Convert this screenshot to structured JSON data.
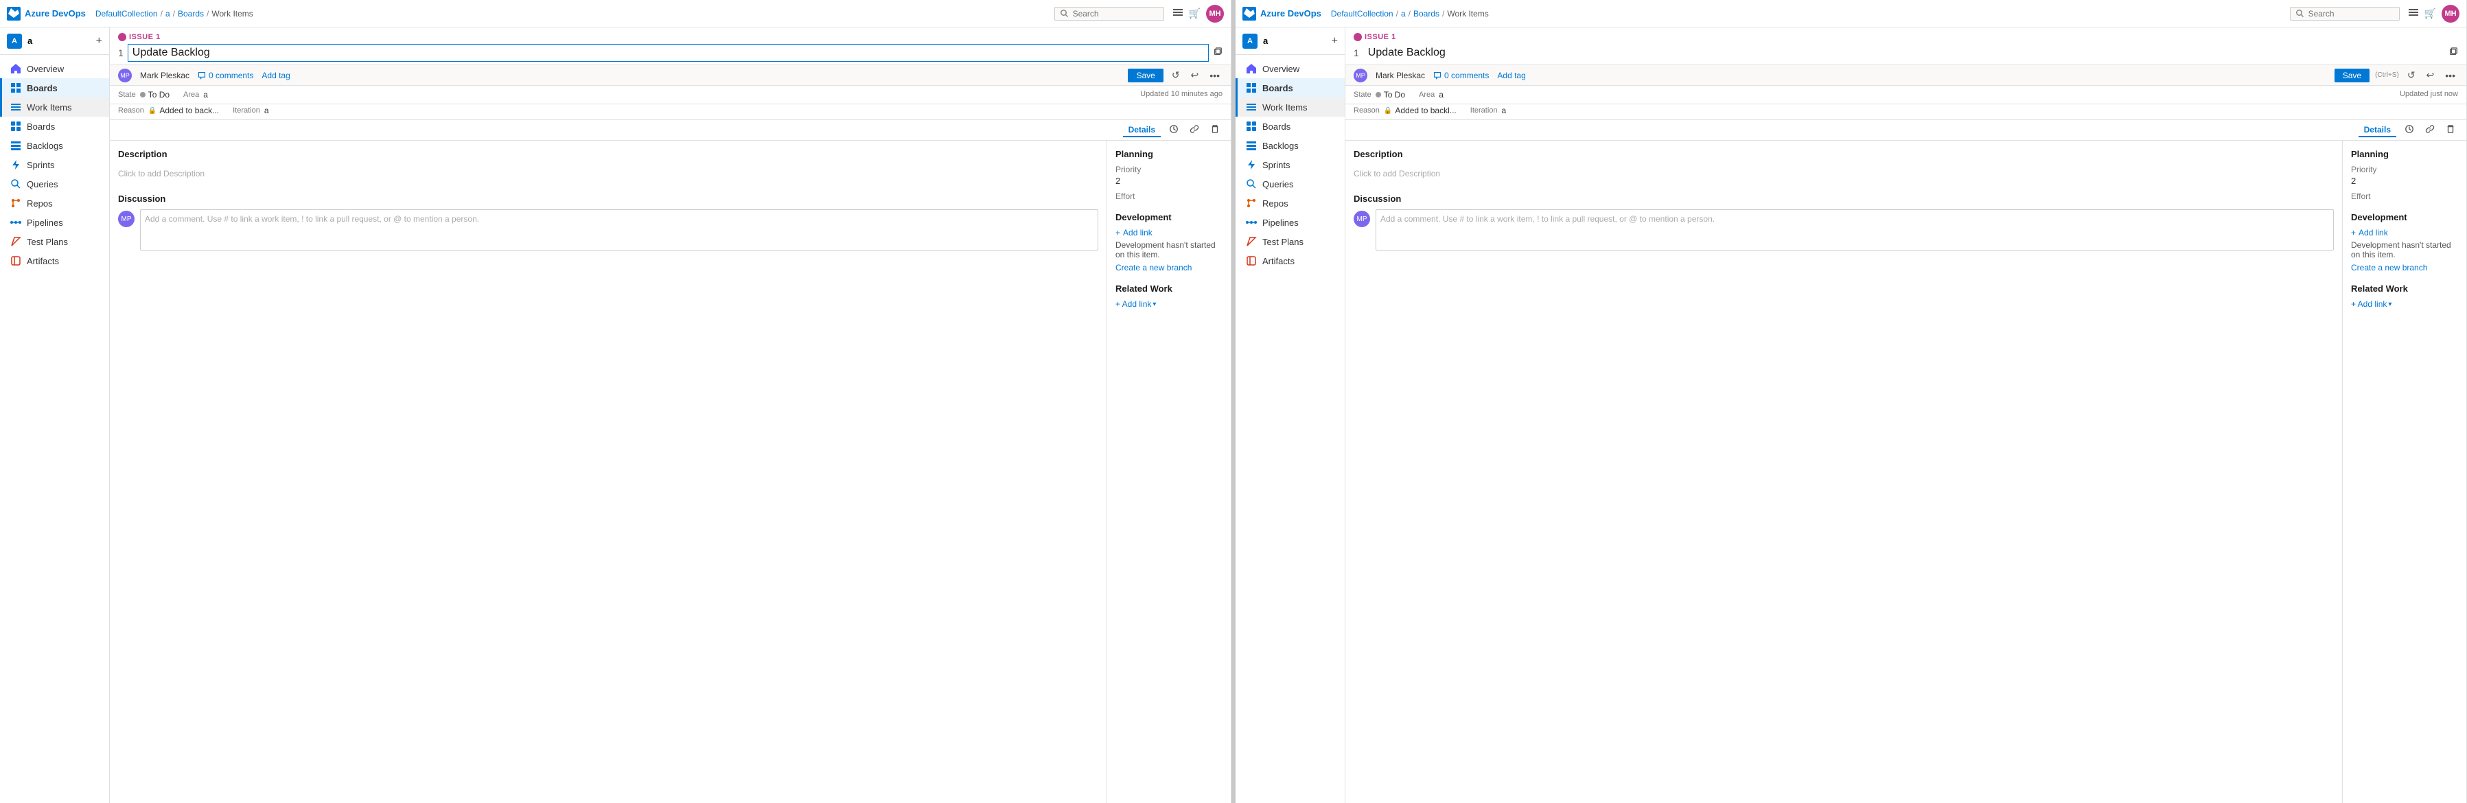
{
  "panels": [
    {
      "id": "left",
      "topbar": {
        "logo_text": "Azure DevOps",
        "breadcrumb": [
          "DefaultCollection",
          "a",
          "Boards",
          "Work Items"
        ],
        "search_placeholder": "Search",
        "avatar_initials": "MH"
      },
      "sidebar": {
        "project_name": "a",
        "project_initial": "A",
        "nav_items": [
          {
            "id": "overview",
            "label": "Overview",
            "icon": "home"
          },
          {
            "id": "boards",
            "label": "Boards",
            "icon": "boards",
            "active": true
          },
          {
            "id": "work-items",
            "label": "Work Items",
            "icon": "list",
            "sub_active": true
          },
          {
            "id": "boards2",
            "label": "Boards",
            "icon": "grid"
          },
          {
            "id": "backlogs",
            "label": "Backlogs",
            "icon": "bars"
          },
          {
            "id": "sprints",
            "label": "Sprints",
            "icon": "lightning"
          },
          {
            "id": "queries",
            "label": "Queries",
            "icon": "search"
          },
          {
            "id": "repos",
            "label": "Repos",
            "icon": "repo"
          },
          {
            "id": "pipelines",
            "label": "Pipelines",
            "icon": "pipeline"
          },
          {
            "id": "test-plans",
            "label": "Test Plans",
            "icon": "test"
          },
          {
            "id": "artifacts",
            "label": "Artifacts",
            "icon": "artifact"
          }
        ]
      },
      "workitem": {
        "issue_label": "ISSUE 1",
        "number": "1",
        "title": "Update Backlog",
        "assignee": "Mark Pleskac",
        "comments": "0 comments",
        "add_tag": "Add tag",
        "state_label": "State",
        "state_value": "To Do",
        "area_label": "Area",
        "area_value": "a",
        "reason_label": "Reason",
        "reason_value": "Added to back...",
        "iteration_label": "Iteration",
        "iteration_value": "a",
        "updated_text": "Updated 10 minutes ago",
        "tab_details": "Details",
        "save_btn": "Save",
        "description_label": "Description",
        "description_placeholder": "Click to add Description",
        "discussion_label": "Discussion",
        "comment_placeholder": "Add a comment. Use # to link a work item, ! to link a pull request, or @ to mention a person.",
        "planning_label": "Planning",
        "priority_label": "Priority",
        "priority_value": "2",
        "effort_label": "Effort",
        "effort_value": "",
        "development_label": "Development",
        "add_link_label": "+ Add link",
        "dev_status": "Development hasn't started on this item.",
        "create_branch": "Create a new branch",
        "related_work_label": "Related Work",
        "add_link_dropdown": "+ Add link",
        "saved": false,
        "updated_status": "Updated 10 minutes ago"
      }
    },
    {
      "id": "right",
      "topbar": {
        "logo_text": "Azure DevOps",
        "breadcrumb": [
          "DefaultCollection",
          "a",
          "Boards",
          "Work Items"
        ],
        "search_placeholder": "Search",
        "avatar_initials": "MH"
      },
      "sidebar": {
        "project_name": "a",
        "project_initial": "A",
        "nav_items": [
          {
            "id": "overview",
            "label": "Overview",
            "icon": "home"
          },
          {
            "id": "boards",
            "label": "Boards",
            "icon": "boards",
            "active": true
          },
          {
            "id": "work-items",
            "label": "Work Items",
            "icon": "list",
            "sub_active": true
          },
          {
            "id": "boards2",
            "label": "Boards",
            "icon": "grid"
          },
          {
            "id": "backlogs",
            "label": "Backlogs",
            "icon": "bars"
          },
          {
            "id": "sprints",
            "label": "Sprints",
            "icon": "lightning"
          },
          {
            "id": "queries",
            "label": "Queries",
            "icon": "search"
          },
          {
            "id": "repos",
            "label": "Repos",
            "icon": "repo"
          },
          {
            "id": "pipelines",
            "label": "Pipelines",
            "icon": "pipeline"
          },
          {
            "id": "test-plans",
            "label": "Test Plans",
            "icon": "test"
          },
          {
            "id": "artifacts",
            "label": "Artifacts",
            "icon": "artifact"
          }
        ]
      },
      "workitem": {
        "issue_label": "ISSUE 1",
        "number": "1",
        "title": "Update Backlog",
        "assignee": "Mark Pleskac",
        "comments": "0 comments",
        "add_tag": "Add tag",
        "state_label": "State",
        "state_value": "To Do",
        "area_label": "Area",
        "area_value": "a",
        "reason_label": "Reason",
        "reason_value": "Added to backl...",
        "iteration_label": "Iteration",
        "iteration_value": "a",
        "updated_text": "Updated just now",
        "tab_details": "Details",
        "save_btn": "Save",
        "save_shortcut": "(Ctrl+S)",
        "description_label": "Description",
        "description_placeholder": "Click to add Description",
        "discussion_label": "Discussion",
        "comment_placeholder": "Add a comment. Use # to link a work item, ! to link a pull request, or @ to mention a person.",
        "planning_label": "Planning",
        "priority_label": "Priority",
        "priority_value": "2",
        "effort_label": "Effort",
        "effort_value": "",
        "development_label": "Development",
        "add_link_label": "+ Add link",
        "dev_status": "Development hasn't started on this item.",
        "create_branch": "Create a new branch",
        "related_work_label": "Related Work",
        "add_link_dropdown": "+ Add link",
        "saved": true,
        "updated_status": "Updated just now"
      }
    }
  ],
  "icons": {
    "home": "⌂",
    "boards": "▦",
    "list": "☰",
    "grid": "⊞",
    "bars": "≡",
    "lightning": "⚡",
    "search": "🔍",
    "repo": "⎇",
    "pipeline": "▷",
    "test": "✓",
    "artifact": "📦",
    "plus": "+",
    "comment": "💬",
    "save": "💾",
    "undo": "↩",
    "redo": "↪",
    "more": "…",
    "history": "⟳",
    "link": "🔗",
    "delete": "🗑",
    "lock": "🔒"
  }
}
